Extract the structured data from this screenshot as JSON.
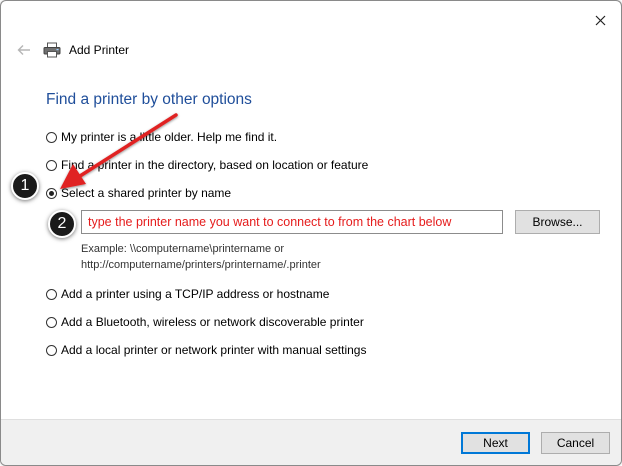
{
  "window": {
    "title": "Add Printer"
  },
  "icons": {
    "close": "close-icon",
    "back": "back-arrow-icon",
    "printer": "printer-icon"
  },
  "heading": "Find a printer by other options",
  "options": [
    {
      "label": "My printer is a little older. Help me find it.",
      "checked": false
    },
    {
      "label": "Find a printer in the directory, based on location or feature",
      "checked": false
    },
    {
      "label": "Select a shared printer by name",
      "checked": true
    },
    {
      "label": "Add a printer using a TCP/IP address or hostname",
      "checked": false
    },
    {
      "label": "Add a Bluetooth, wireless or network discoverable printer",
      "checked": false
    },
    {
      "label": "Add a local printer or network printer with manual settings",
      "checked": false
    }
  ],
  "shared_name": {
    "value": "type the printer name you want to connect to from the chart below",
    "browse_label": "Browse...",
    "example_line1": "Example: \\\\computername\\printername or",
    "example_line2": "http://computername/printers/printername/.printer"
  },
  "footer": {
    "next_label": "Next",
    "cancel_label": "Cancel"
  },
  "callouts": {
    "one": "1",
    "two": "2"
  },
  "colors": {
    "heading": "#1f4e9a",
    "annotation": "#e51c1c",
    "accent": "#0078d7"
  }
}
